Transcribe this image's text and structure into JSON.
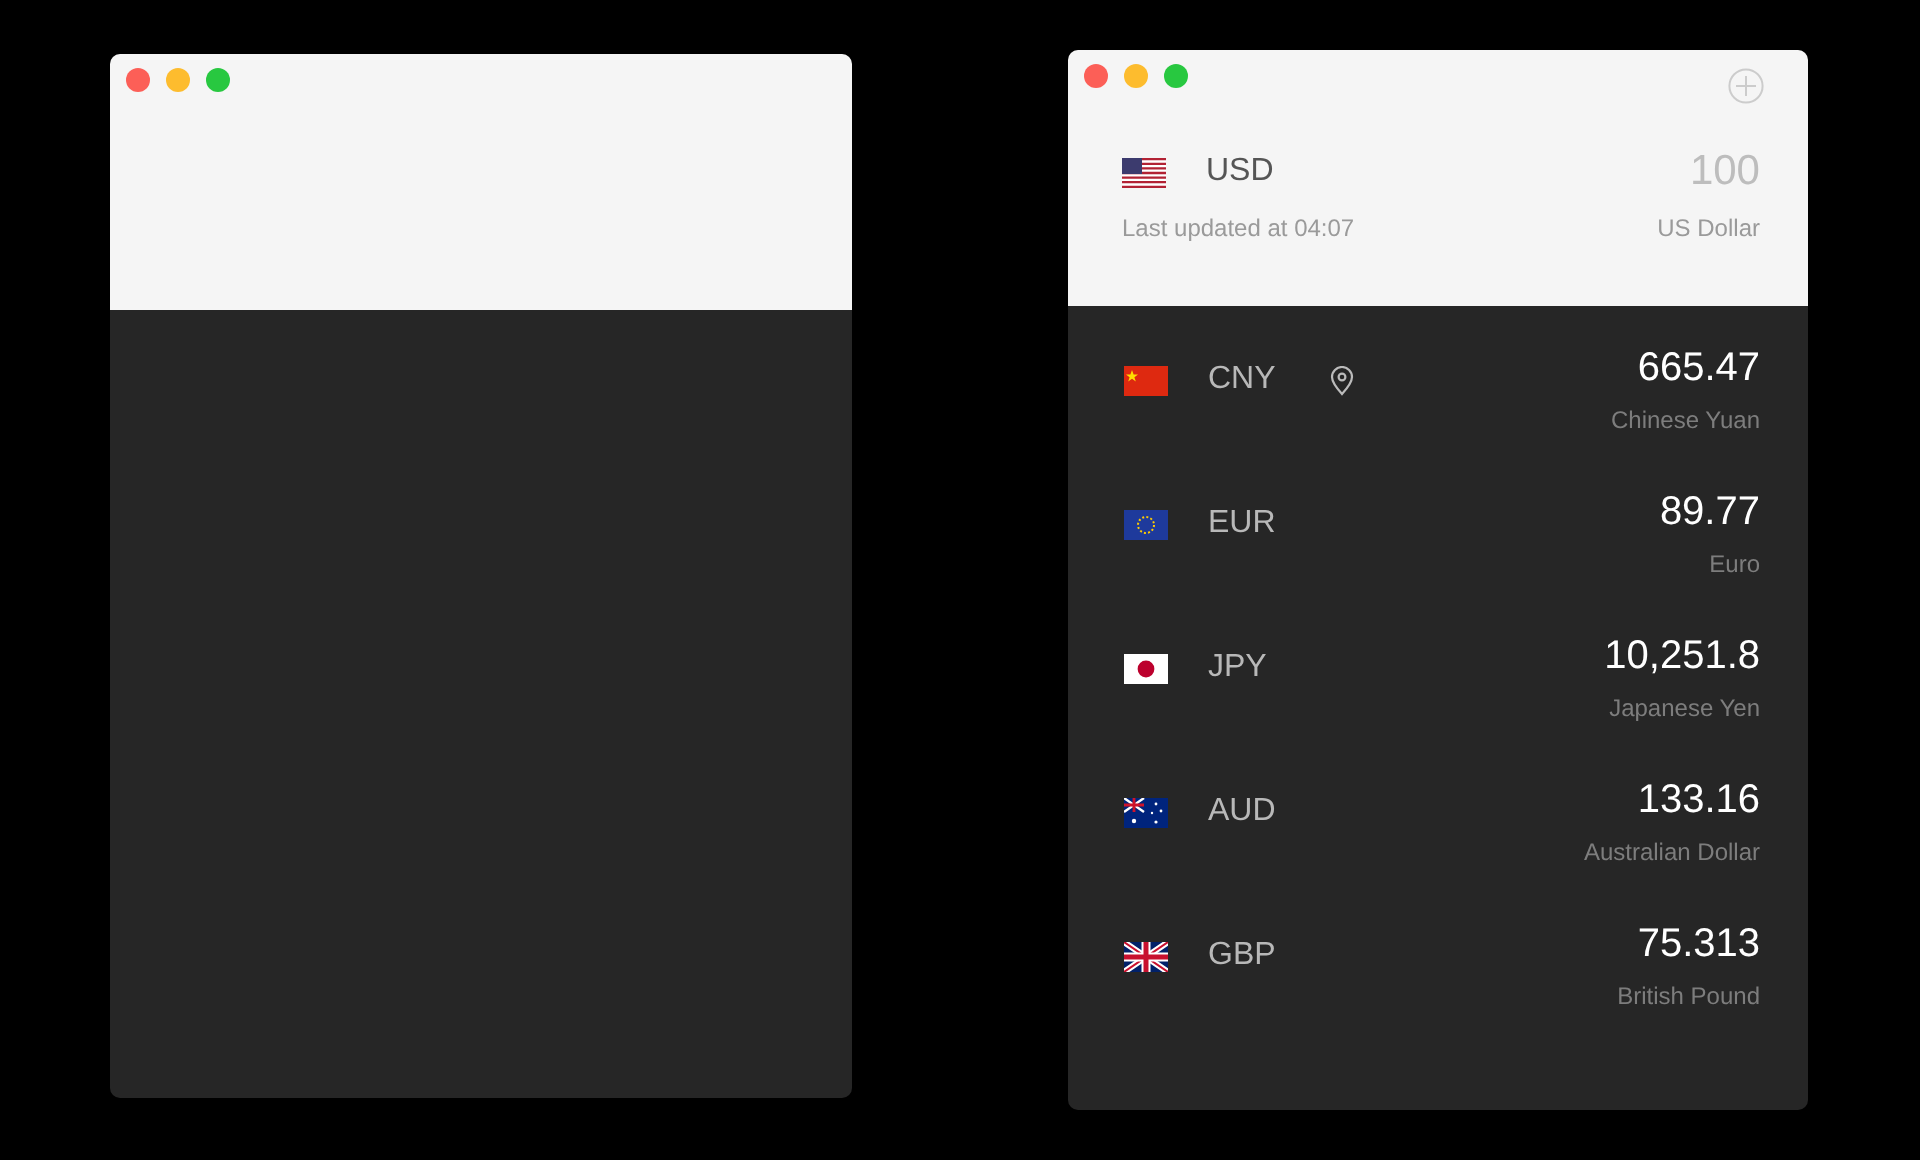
{
  "windows": [
    {
      "kind": "empty"
    },
    {
      "kind": "converter",
      "base": {
        "code": "USD",
        "amount": "100",
        "name": "US Dollar",
        "updated": "Last updated at 04:07"
      },
      "rows": [
        {
          "code": "CNY",
          "value": "665.47",
          "name": "Chinese Yuan",
          "current_location": true
        },
        {
          "code": "EUR",
          "value": "89.77",
          "name": "Euro",
          "current_location": false
        },
        {
          "code": "JPY",
          "value": "10,251.8",
          "name": "Japanese Yen",
          "current_location": false
        },
        {
          "code": "AUD",
          "value": "133.16",
          "name": "Australian Dollar",
          "current_location": false
        },
        {
          "code": "GBP",
          "value": "75.313",
          "name": "British Pound",
          "current_location": false
        }
      ]
    }
  ]
}
